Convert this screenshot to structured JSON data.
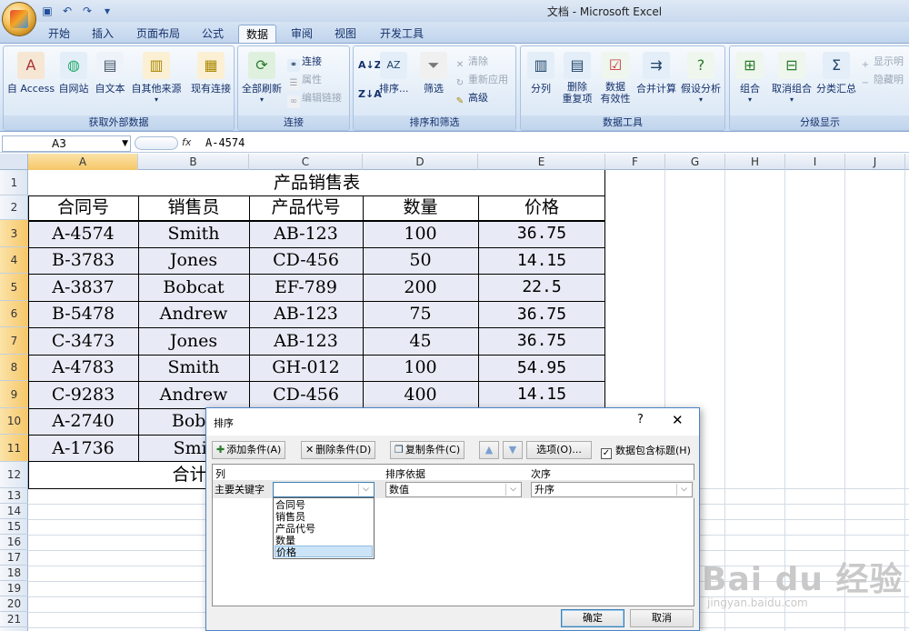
{
  "window": {
    "title": "文档 - Microsoft Excel"
  },
  "tabs": [
    "开始",
    "插入",
    "页面布局",
    "公式",
    "数据",
    "审阅",
    "视图",
    "开发工具"
  ],
  "active_tab": "数据",
  "ribbon": {
    "external_data": {
      "label": "获取外部数据",
      "buttons": [
        "自 Access",
        "自网站",
        "自文本",
        "自其他来源",
        "现有连接"
      ]
    },
    "connections": {
      "label": "连接",
      "refresh": "全部刷新",
      "small": [
        "连接",
        "属性",
        "编辑链接"
      ]
    },
    "sort_filter": {
      "label": "排序和筛选",
      "sort": "排序...",
      "filter": "筛选",
      "small": [
        "清除",
        "重新应用",
        "高级"
      ]
    },
    "data_tools": {
      "label": "数据工具",
      "buttons": [
        "分列",
        "删除\n重复项",
        "数据\n有效性",
        "合并计算",
        "假设分析"
      ]
    },
    "outline": {
      "label": "分级显示",
      "buttons": [
        "组合",
        "取消组合",
        "分类汇总"
      ],
      "small": [
        "显示明",
        "隐藏明"
      ]
    }
  },
  "formula_bar": {
    "name_box": "A3",
    "fx": "fx",
    "content": "A-4574"
  },
  "columns": [
    "A",
    "B",
    "C",
    "D",
    "E",
    "F",
    "G",
    "H",
    "I",
    "J"
  ],
  "rows": [
    "1",
    "2",
    "3",
    "4",
    "5",
    "6",
    "7",
    "8",
    "9",
    "10",
    "11",
    "12",
    "13",
    "14",
    "15",
    "16",
    "17",
    "18",
    "19",
    "20",
    "21"
  ],
  "sheet": {
    "title": "产品销售表",
    "headers": [
      "合同号",
      "销售员",
      "产品代号",
      "数量",
      "价格"
    ],
    "data": [
      [
        "A-4574",
        "Smith",
        "AB-123",
        "100",
        "36.75"
      ],
      [
        "B-3783",
        "Jones",
        "CD-456",
        "50",
        "14.15"
      ],
      [
        "A-3837",
        "Bobcat",
        "EF-789",
        "200",
        "22.5"
      ],
      [
        "B-5478",
        "Andrew",
        "AB-123",
        "75",
        "36.75"
      ],
      [
        "C-3473",
        "Jones",
        "AB-123",
        "45",
        "36.75"
      ],
      [
        "A-4783",
        "Smith",
        "GH-012",
        "100",
        "54.95"
      ],
      [
        "C-9283",
        "Andrew",
        "CD-456",
        "400",
        "14.15"
      ],
      [
        "A-2740",
        "Bobc",
        "",
        "",
        ""
      ],
      [
        "A-1736",
        "Smit",
        "",
        "",
        ""
      ]
    ],
    "total_label": "合计"
  },
  "dialog": {
    "title": "排序",
    "help": "?",
    "close": "✕",
    "add_condition": "添加条件(A)",
    "delete_condition": "删除条件(D)",
    "copy_condition": "复制条件(C)",
    "options": "选项(O)...",
    "has_headers": "数据包含标题(H)",
    "col_header": "列",
    "sort_on_header": "排序依据",
    "order_header": "次序",
    "primary_key_label": "主要关键字",
    "primary_key_value": "",
    "sort_on_value": "数值",
    "order_value": "升序",
    "dropdown_options": [
      "合同号",
      "销售员",
      "产品代号",
      "数量",
      "价格"
    ],
    "highlighted_option": "价格",
    "ok": "确定",
    "cancel": "取消"
  },
  "watermark": {
    "text": "Bai du 经验",
    "url": "jingyan.baidu.com"
  }
}
